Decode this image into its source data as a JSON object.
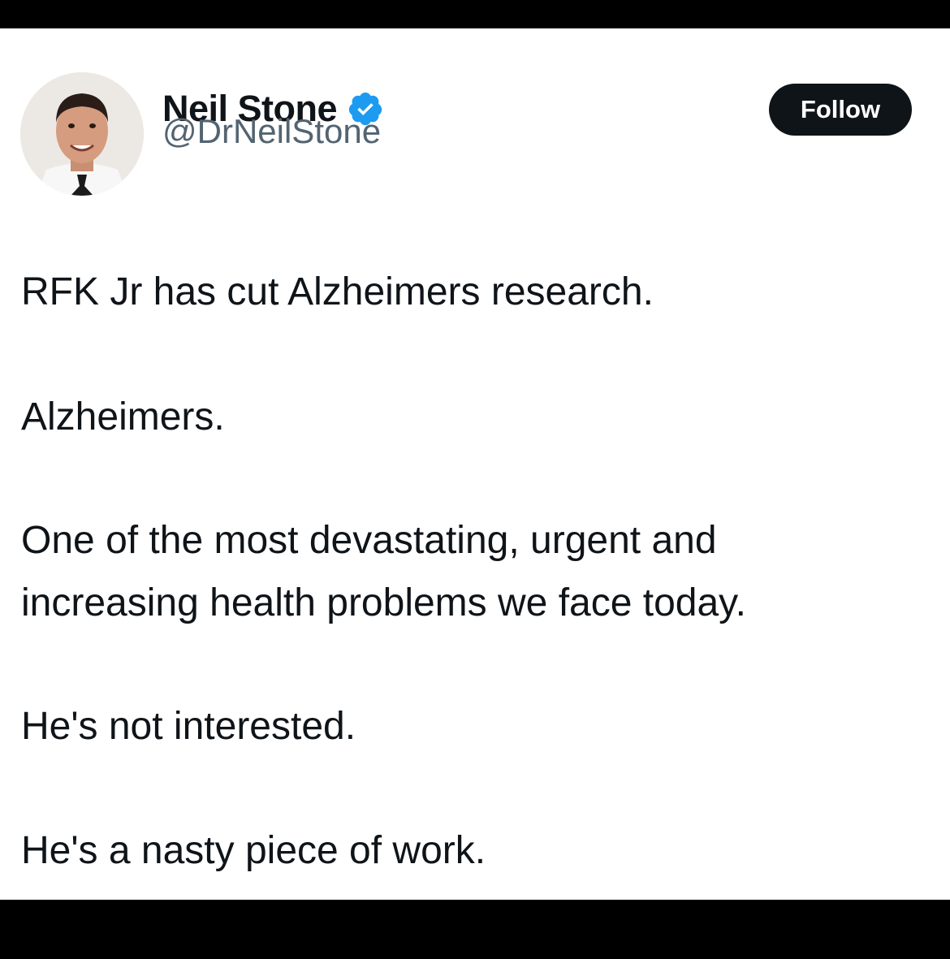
{
  "author": {
    "display_name": "Neil Stone",
    "handle": "@DrNeilStone",
    "verified": true,
    "avatar_icon": "profile-photo-icon",
    "verified_icon": "verified-badge-icon",
    "verified_color": "#1d9bf0"
  },
  "actions": {
    "follow_label": "Follow"
  },
  "tweet": {
    "lines": [
      "RFK Jr has cut Alzheimers research.",
      "Alzheimers.",
      "One of the most devastating, urgent and",
      "increasing health problems we face today.",
      "He's not interested.",
      "He's a nasty piece of work."
    ]
  },
  "colors": {
    "text_primary": "#0f1419",
    "text_secondary": "#536471",
    "button_background": "#0f1419",
    "background": "#ffffff",
    "frame": "#000000"
  }
}
